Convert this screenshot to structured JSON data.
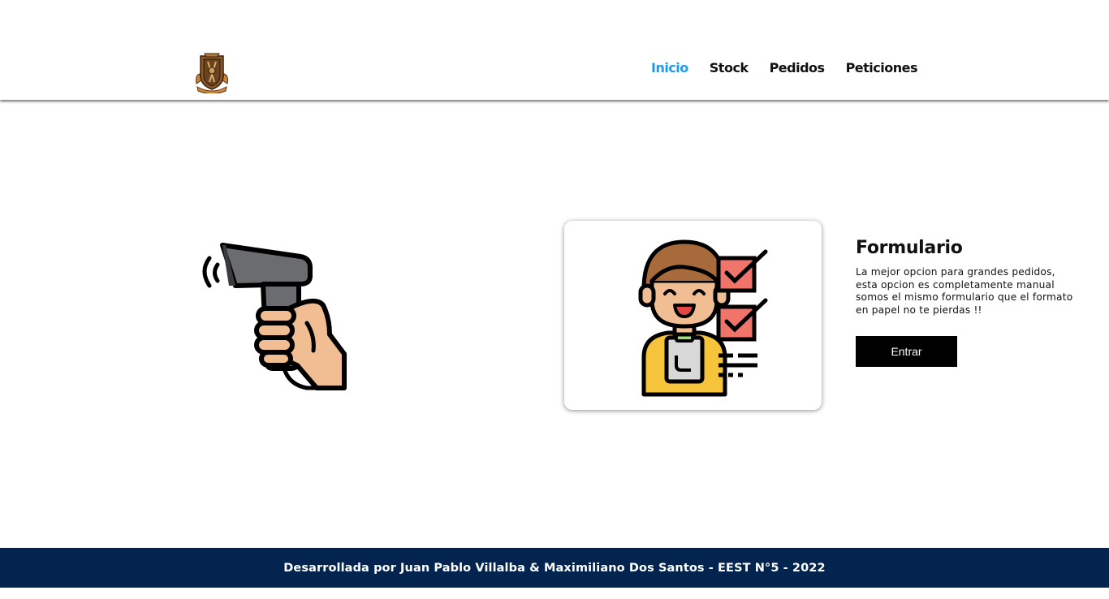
{
  "header": {
    "logo_icon": "school-crest-logo",
    "nav": [
      {
        "label": "Inicio",
        "active": true
      },
      {
        "label": "Stock",
        "active": false
      },
      {
        "label": "Pedidos",
        "active": false
      },
      {
        "label": "Peticiones",
        "active": false
      }
    ]
  },
  "main": {
    "scanner_icon": "barcode-scanner-hand-icon",
    "card_icon": "person-checklist-illustration",
    "title": "Formulario",
    "description": "La mejor opcion para grandes pedidos, esta opcion es completamente manual somos el mismo formulario que el formato en papel no te pierdas !!",
    "button_label": "Entrar"
  },
  "footer": {
    "text": "Desarrollada por Juan Pablo Villalba & Maximiliano Dos Santos - EEST N°5 - 2022"
  },
  "colors": {
    "nav_active": "#1e9be9",
    "footer_bg": "#03244f",
    "button_bg": "#000000"
  }
}
